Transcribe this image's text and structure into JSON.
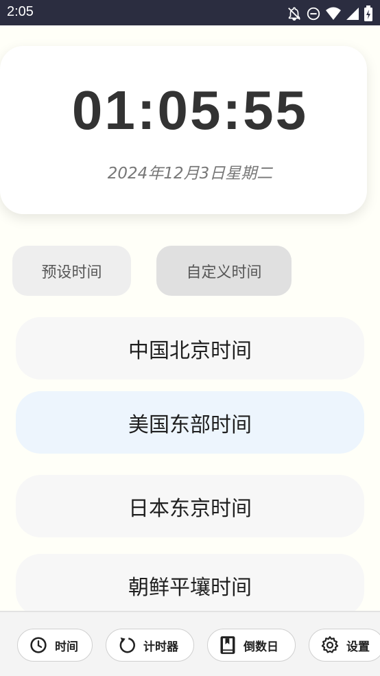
{
  "status_bar": {
    "time": "2:05",
    "icons": [
      "notifications-off-icon",
      "do-not-disturb-icon",
      "wifi-icon",
      "signal-icon",
      "battery-icon"
    ]
  },
  "clock": {
    "time": "01:05:55",
    "date": "2024年12月3日星期二"
  },
  "modes": {
    "preset": "预设时间",
    "custom": "自定义时间"
  },
  "zones": [
    {
      "label": "中国北京时间"
    },
    {
      "label": "美国东部时间",
      "selected": true
    },
    {
      "label": "日本东京时间"
    },
    {
      "label": "朝鲜平壤时间"
    }
  ],
  "nav": {
    "time": {
      "label": "时间",
      "icon": "clock-icon"
    },
    "timer": {
      "label": "计时器",
      "icon": "refresh-icon"
    },
    "countdown": {
      "label": "倒数日",
      "icon": "book-icon"
    },
    "settings": {
      "label": "设置",
      "icon": "gear-icon"
    }
  },
  "colors": {
    "status_bar": "#2b2d40",
    "background": "#fffff8",
    "selected_zone": "#edf5fd"
  }
}
